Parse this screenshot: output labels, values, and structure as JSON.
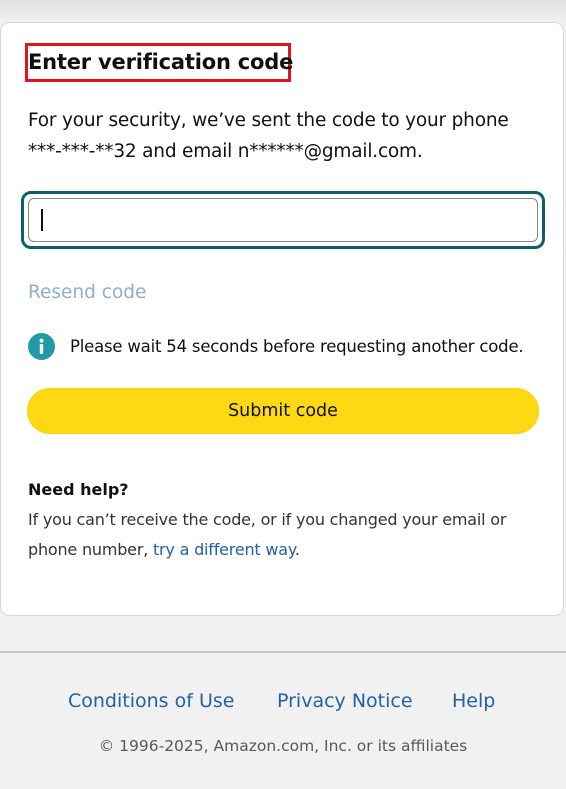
{
  "card": {
    "title": "Enter verification code",
    "description_line1": "For your security, we’ve sent the code to your phone",
    "description_line2": "***-***-**32 and email n******@gmail.com.",
    "otp_input": {
      "value": "",
      "placeholder": ""
    },
    "resend_label": "Resend code",
    "info_icon": "info-circle-icon",
    "info_message": "Please wait 54 seconds before requesting another code.",
    "submit_label": "Submit code",
    "help": {
      "heading": "Need help?",
      "text_line1": "If you can’t receive the code, or if you changed your email or",
      "text_line2_prefix": "phone number, ",
      "link_label": "try a different way",
      "text_line2_suffix": "."
    }
  },
  "footer": {
    "links": [
      "Conditions of Use",
      "Privacy Notice",
      "Help"
    ],
    "copyright": "© 1996-2025, Amazon.com, Inc. or its affiliates"
  },
  "colors": {
    "accent_button": "#ffd814",
    "input_focus_ring": "#0e5f6b",
    "link": "#2162a1",
    "info_icon": "#1f9aa6",
    "highlight_box": "#e0141e"
  }
}
